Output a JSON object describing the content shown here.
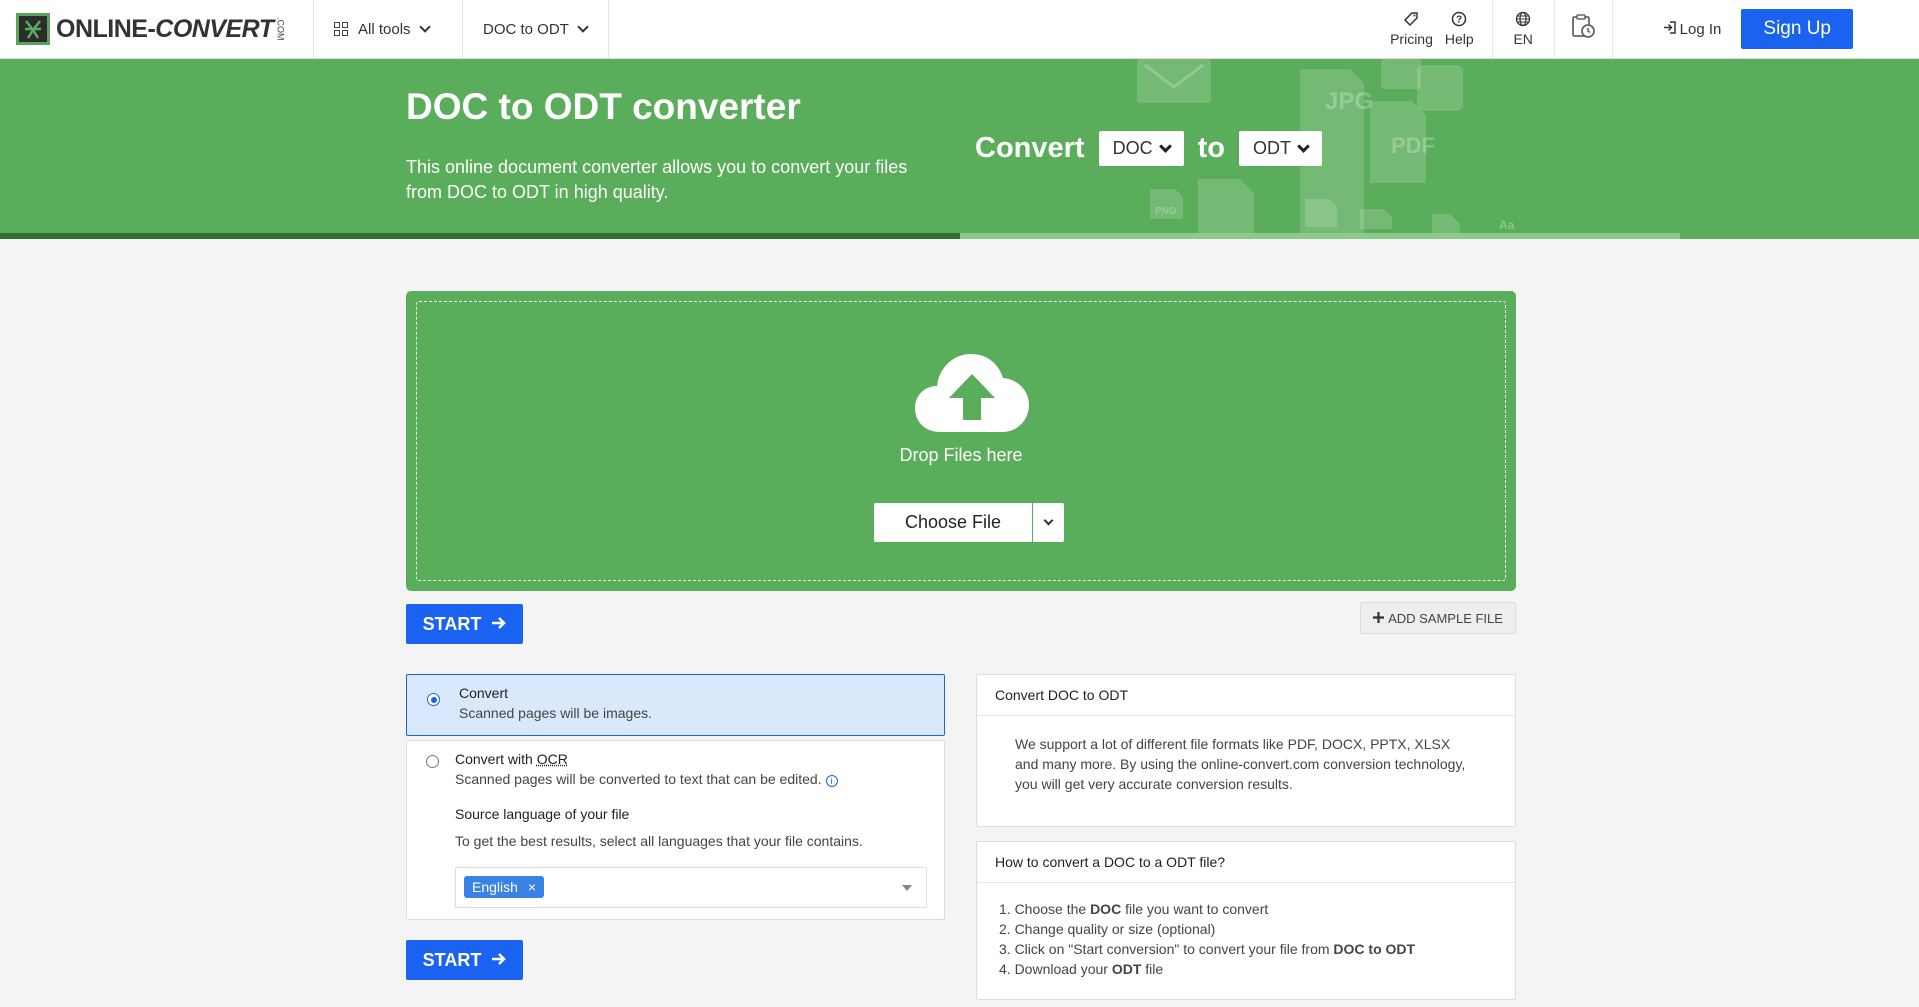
{
  "header": {
    "logo_main": "ONLINE-",
    "logo_conv": "CONVERT",
    "logo_com": ".COM",
    "all_tools": "All tools",
    "converter_menu": "DOC to ODT",
    "pricing": "Pricing",
    "help": "Help",
    "language": "EN",
    "login": "Log In",
    "signup": "Sign Up"
  },
  "banner": {
    "title": "DOC to ODT converter",
    "description": "This online document converter allows you to convert your files from DOC to ODT in high quality.",
    "convert_label": "Convert",
    "from_format": "DOC",
    "to_label": "to",
    "to_format": "ODT",
    "deco_labels": [
      "JPG",
      "PDF",
      "PNG",
      "Aa"
    ]
  },
  "dropzone": {
    "drop_text": "Drop Files here",
    "choose_file": "Choose File"
  },
  "actions": {
    "start": "START",
    "add_sample": "ADD SAMPLE FILE"
  },
  "options": {
    "convert": {
      "title": "Convert",
      "subtitle": "Scanned pages will be images."
    },
    "ocr": {
      "title_prefix": "Convert with ",
      "title_ocr": "OCR",
      "subtitle": "Scanned pages will be converted to text that can be edited.",
      "source_lang_title": "Source language of your file",
      "source_lang_hint": "To get the best results, select all languages that your file contains.",
      "selected_language": "English",
      "remove_tag": "×"
    }
  },
  "info": {
    "card1": {
      "title": "Convert DOC to ODT",
      "body": "We support a lot of different file formats like PDF, DOCX, PPTX, XLSX and many more. By using the online-convert.com conversion technology, you will get very accurate conversion results."
    },
    "card2": {
      "title": "How to convert a DOC to a ODT file?",
      "steps": [
        {
          "pre": "1. Choose the ",
          "b": "DOC",
          "post": " file you want to convert"
        },
        {
          "pre": "2. Change quality or size (optional)",
          "b": "",
          "post": ""
        },
        {
          "pre": "3. Click on \"Start conversion\" to convert your file from ",
          "b": "DOC to ODT",
          "post": ""
        },
        {
          "pre": "4. Download your ",
          "b": "ODT",
          "post": " file"
        }
      ]
    }
  },
  "colors": {
    "brand_green": "#5aad5a",
    "primary_blue": "#1a62f0"
  }
}
